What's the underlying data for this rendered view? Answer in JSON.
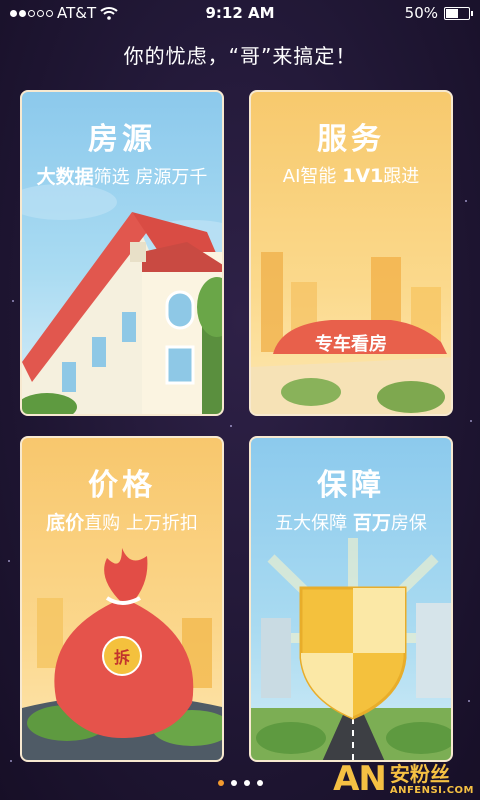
{
  "status_bar": {
    "carrier": "AT&T",
    "time": "9:12 AM",
    "battery": "50%"
  },
  "headline": "你的忧虑，“哥”来搞定！",
  "cards": [
    {
      "title": "房源",
      "sub_bold": "大数据",
      "sub_rest": "筛选   房源万千",
      "colors": {
        "bg": "#8cc9ec"
      }
    },
    {
      "title": "服务",
      "sub_pre": "AI智能  ",
      "sub_bold": "1V1",
      "sub_rest": "跟进",
      "banner": "专车看房",
      "colors": {
        "bg": "#f7c96d"
      }
    },
    {
      "title": "价格",
      "sub_bold": "底价",
      "sub_rest": "直购   上万折扣",
      "coin": "拆",
      "colors": {
        "bg": "#f8c76d"
      }
    },
    {
      "title": "保障",
      "sub_pre": "五大保障  ",
      "sub_bold": "百万",
      "sub_rest": "房保",
      "colors": {
        "bg": "#8ccaed"
      }
    }
  ],
  "pager": {
    "count": 4,
    "active": 0
  },
  "watermark": {
    "logo": "AN",
    "cn": "安粉丝",
    "en": "ANFENSI.COM"
  },
  "icons": [
    "wifi-icon",
    "battery-icon",
    "signal-icon"
  ]
}
